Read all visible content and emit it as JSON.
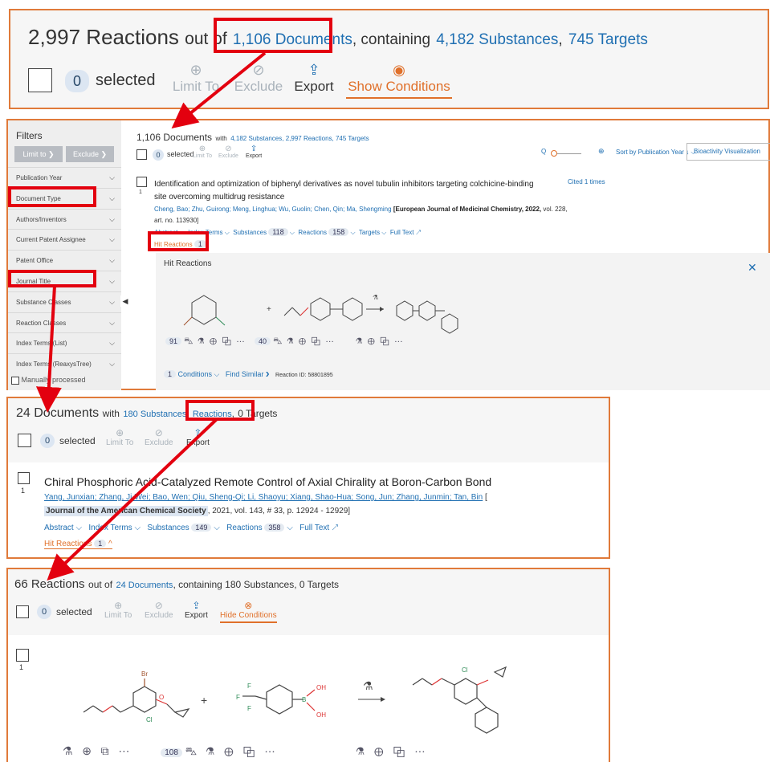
{
  "top": {
    "count": "2,997 Reactions",
    "out_of": "out of",
    "docs": "1,106 Documents",
    "containing": ", containing",
    "subs": "4,182 Substances",
    "comma": ",",
    "targets": "745 Targets",
    "selected_count": "0",
    "selected": "selected",
    "limit": "Limit To",
    "exclude": "Exclude",
    "export": "Export",
    "show_conditions": "Show Conditions"
  },
  "filters": {
    "title": "Filters",
    "limit_btn": "Limit to ❯",
    "exclude_btn": "Exclude ❯",
    "items": [
      "Publication Year",
      "Document Type",
      "Authors/Inventors",
      "Current Patent Assignee",
      "Patent Office",
      "Journal Title",
      "Substance Classes",
      "Reaction Classes",
      "Index Terms (List)",
      "Index Terms (ReaxysTree)"
    ],
    "manually": "Manually processed"
  },
  "docs": {
    "count": "1,106 Documents",
    "with": "with",
    "stats": "4,182 Substances, 2,997 Reactions, 745 Targets",
    "selected_count": "0",
    "selected": "selected",
    "limit": "Limit To",
    "exclude": "Exclude",
    "export": "Export",
    "sort": "Sort by Publication Year ↓ ⌵",
    "bioactivity": "Bioactivity Visualization",
    "item_index": "1",
    "title_line1": "Identification and optimization of biphenyl derivatives as novel tubulin inhibitors targeting colchicine-binding",
    "title_line2": "site overcoming multidrug resistance",
    "authors": "Cheng, Bao; Zhu, Guirong; Meng, Linghua; Wu, Guolin; Chen, Qin; Ma, Shengming",
    "journal": "[European Journal of Medicinal Chemistry, 2022,",
    "volume": "vol. 228,",
    "artno": "art. no. 113930]",
    "cited": "Cited 1 times",
    "links": {
      "abstract": "Abstract ⌵",
      "index_terms": "Index Terms ⌵",
      "substances": "Substances",
      "substances_n": "118",
      "reactions": "Reactions",
      "reactions_n": "158",
      "targets": "Targets ⌵",
      "fulltext": "Full Text ↗"
    },
    "hit": "Hit Reactions",
    "hit_n": "1",
    "hit_panel_title": "Hit Reactions",
    "close": "✕",
    "reagent_count_1": "91",
    "reagent_count_2": "40",
    "conditions_n": "1",
    "conditions": "Conditions ⌵",
    "find_similar": "Find Similar ❯",
    "reaction_id": "Reaction ID: 58801895"
  },
  "docs24": {
    "count": "24 Documents",
    "with": "with",
    "subs": "180 Substances",
    "comma": ",",
    "reactions": "Reactions",
    "comma2": ",",
    "targets": "0 Targets",
    "selected_count": "0",
    "selected": "selected",
    "limit": "Limit To",
    "exclude": "Exclude",
    "export": "Export",
    "item_index": "1",
    "title": "Chiral Phosphoric Acid-Catalyzed Remote Control of Axial Chirality at Boron-Carbon Bond",
    "authors": "Yang, Junxian; Zhang, Ji-Wei; Bao, Wen; Qiu, Sheng-Qi; Li, Shaoyu; Xiang, Shao-Hua; Song, Jun; Zhang, Junmin; Tan, Bin",
    "bracket": "[",
    "journal": "Journal of the American Chemical Society",
    "journal_rest": ", 2021, vol. 143, # 33, p. 12924 - 12929]",
    "abstract": "Abstract ⌵",
    "index_terms": "Index Terms ⌵",
    "substances": "Substances",
    "substances_n": "149",
    "reactions_n": "358",
    "fulltext": "Full Text ↗",
    "hit": "Hit Reactions",
    "hit_n": "1"
  },
  "react66": {
    "count": "66 Reactions",
    "out_of": "out of",
    "docs": "24 Documents",
    "containing": ", containing 180 Substances, 0 Targets",
    "selected_count": "0",
    "selected": "selected",
    "limit": "Limit To",
    "exclude": "Exclude",
    "export": "Export",
    "hide_conditions": "Hide Conditions",
    "item_index": "1",
    "reagent_count": "108"
  }
}
